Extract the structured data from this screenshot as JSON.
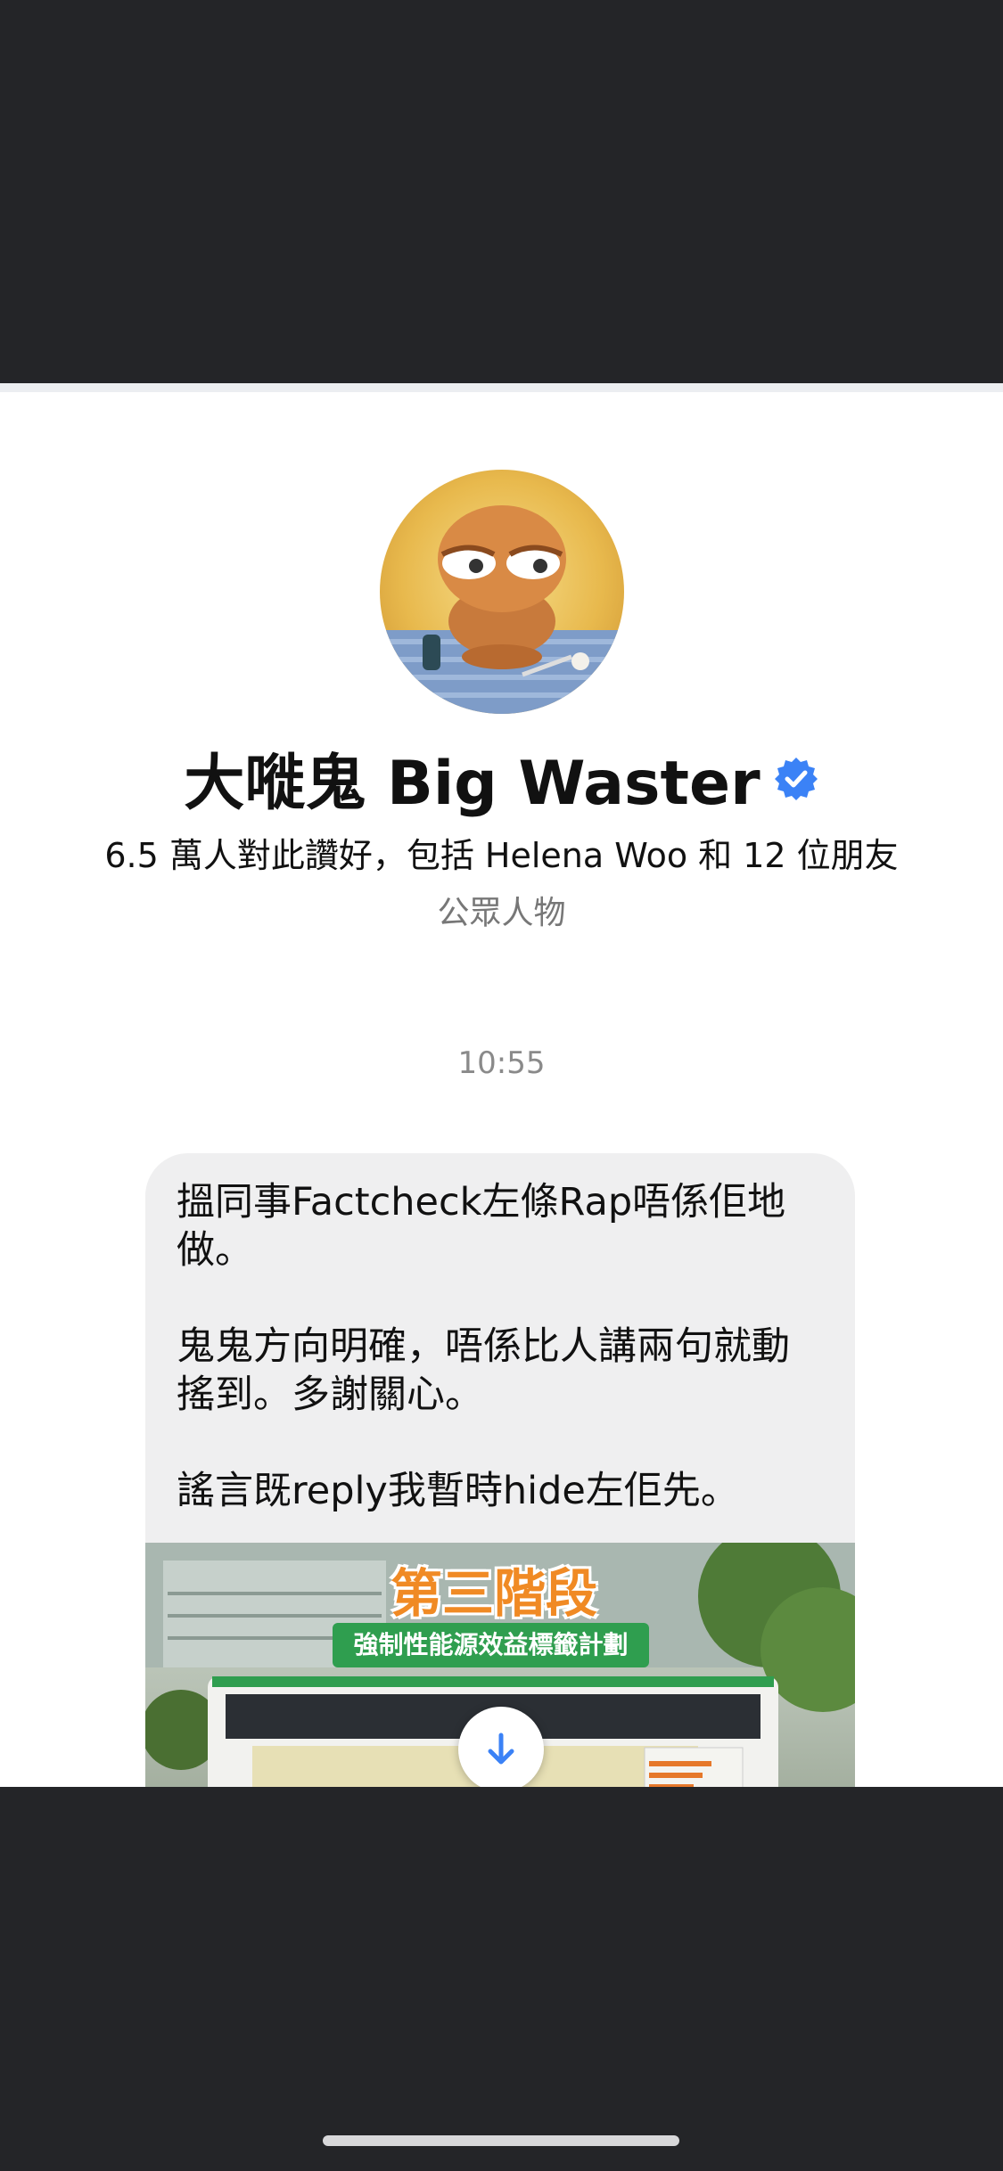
{
  "profile": {
    "name": "大嘥鬼 Big Waster",
    "likes_line": "6.5 萬人對此讚好，包括 Helena Woo 和 12 位朋友",
    "category": "公眾人物",
    "verified_icon": "verified-badge-icon",
    "accent": "#3b82f6"
  },
  "chat": {
    "timestamp": "10:55",
    "message_text": "搵同事Factcheck左條Rap唔係佢地做。\n\n鬼鬼方向明確，唔係比人講兩句就動搖到。多謝關心。\n\n謠言既reply我暫時hide左佢先。",
    "image": {
      "title": "第三階段",
      "subtitle": "強制性能源效益標籤計劃"
    },
    "scroll_icon": "arrow-down-icon"
  },
  "colors": {
    "background_dark": "#242528",
    "bubble": "#efeff0"
  }
}
